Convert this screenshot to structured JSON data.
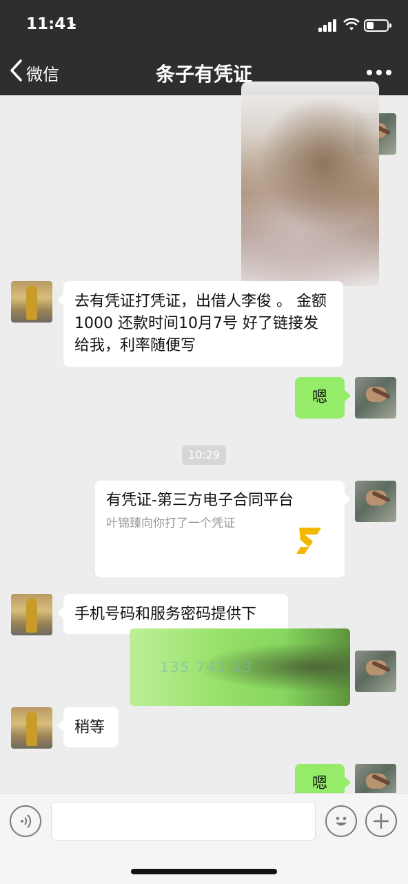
{
  "status_bar": {
    "time": "11:41"
  },
  "navbar": {
    "back_label": "微信",
    "title": "条子有凭证"
  },
  "messages": {
    "m1": "去有凭证打凭证，出借人李俊 。 金额1000 还款时间10月7号  好了链接发给我，利率随便写",
    "m2": "嗯",
    "timestamp": "10:29",
    "card": {
      "title": "有凭证-第三方电子合同平台",
      "subtitle": "叶锦臻向你打了一个凭证"
    },
    "m4": "手机号码和服务密码提供下",
    "redacted_digits": "135    742    23",
    "m5": "稍等",
    "m6": "嗯"
  },
  "input": {
    "value": "",
    "placeholder": ""
  },
  "icons": {
    "voice": "voice-icon",
    "emoji": "emoji-icon",
    "add": "plus-icon",
    "back": "chevron-left-icon",
    "more": "more-dots-icon"
  },
  "colors": {
    "bar": "#2e2e2e",
    "chat_bg": "#ededed",
    "self_bubble": "#95ec69"
  }
}
